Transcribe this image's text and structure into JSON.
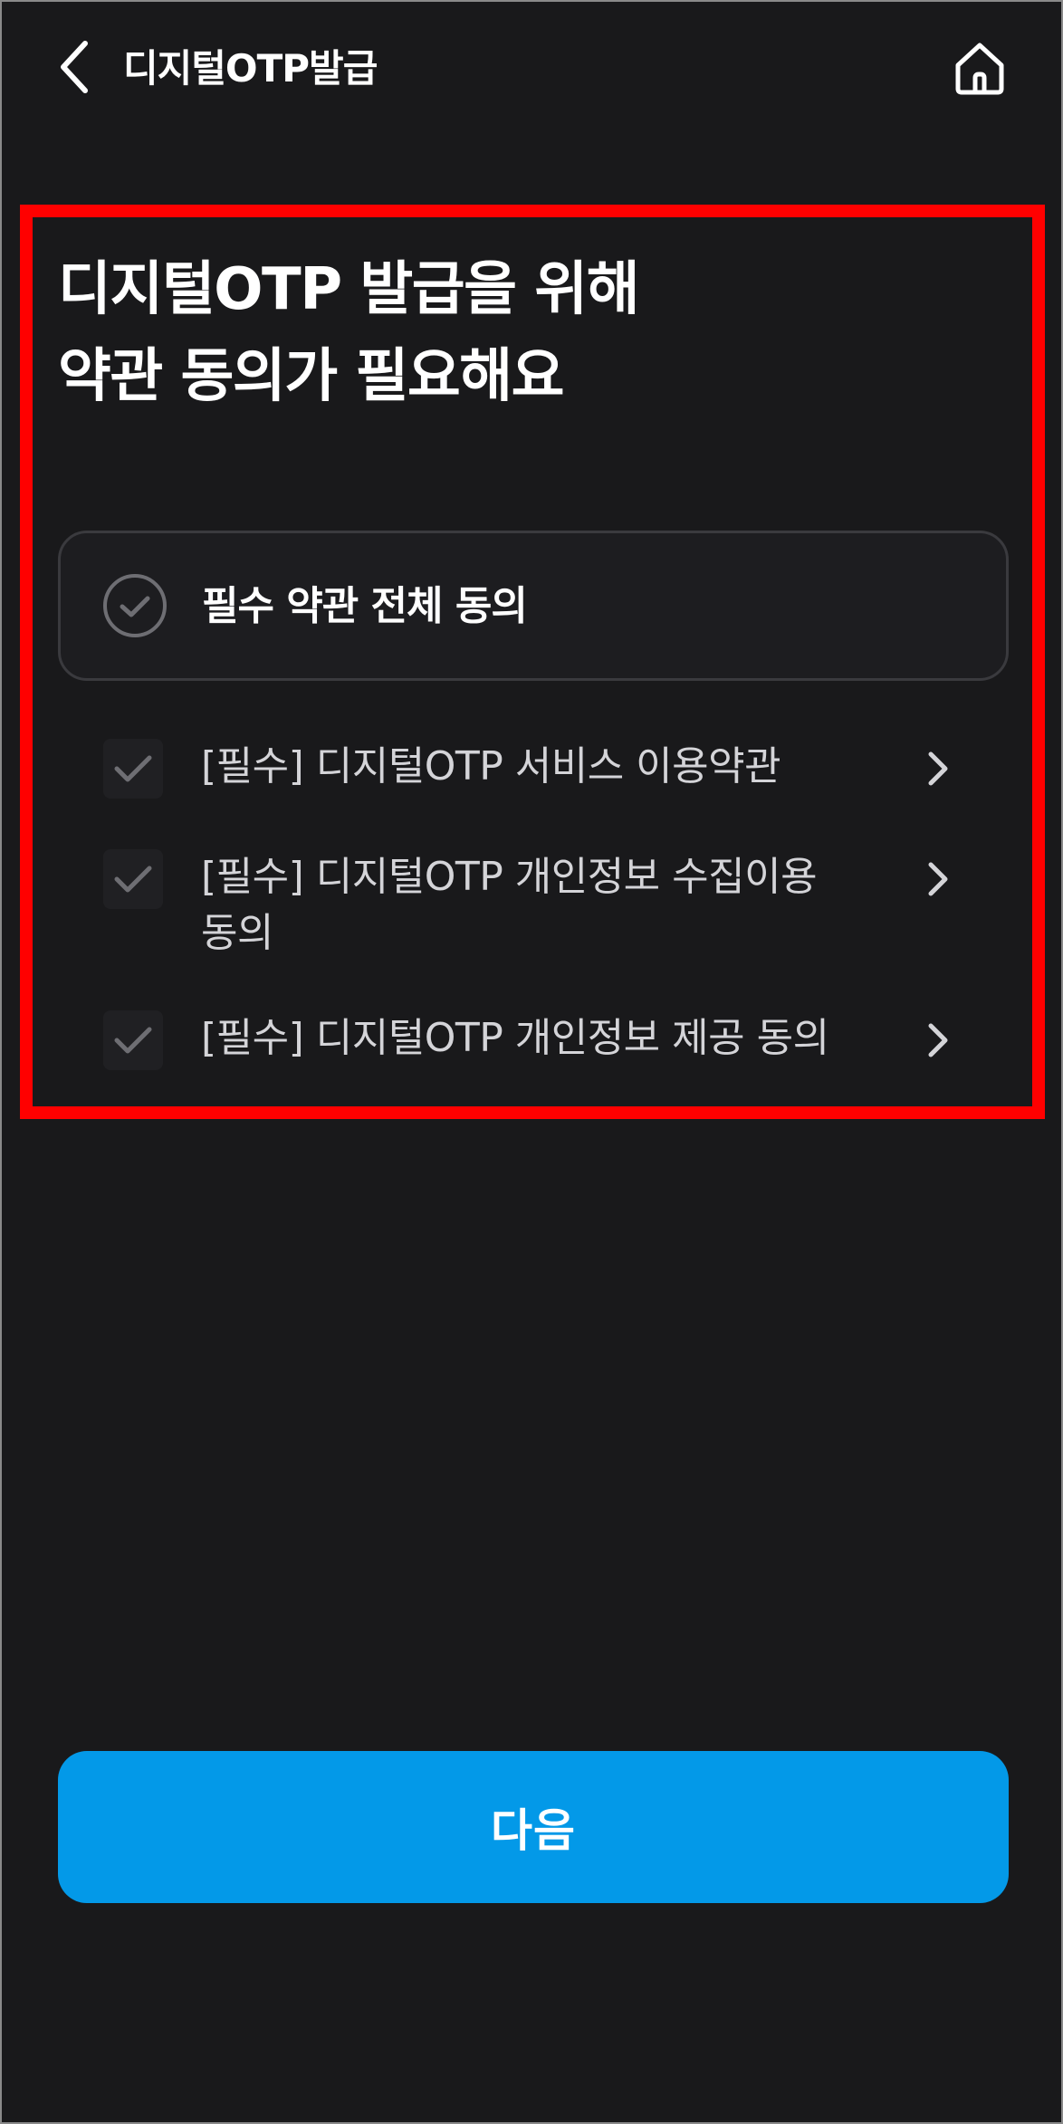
{
  "header": {
    "title": "디지털OTP발급",
    "back_icon": "chevron-left-icon",
    "home_icon": "home-icon"
  },
  "headline": {
    "line1": "디지털OTP 발급을 위해",
    "line2": "약관 동의가 필요해요"
  },
  "agree_all": {
    "label": "필수 약관 전체 동의",
    "checked": false
  },
  "terms": [
    {
      "label": "[필수] 디지털OTP 서비스 이용약관",
      "checked": false
    },
    {
      "label": "[필수] 디지털OTP 개인정보 수집이용 동의",
      "checked": false
    },
    {
      "label": "[필수] 디지털OTP 개인정보 제공 동의",
      "checked": false
    }
  ],
  "next_button": {
    "label": "다음"
  },
  "colors": {
    "background": "#19191b",
    "primary": "#0399e8",
    "highlight_border": "#ff0000",
    "muted_check": "#6e6e73"
  }
}
